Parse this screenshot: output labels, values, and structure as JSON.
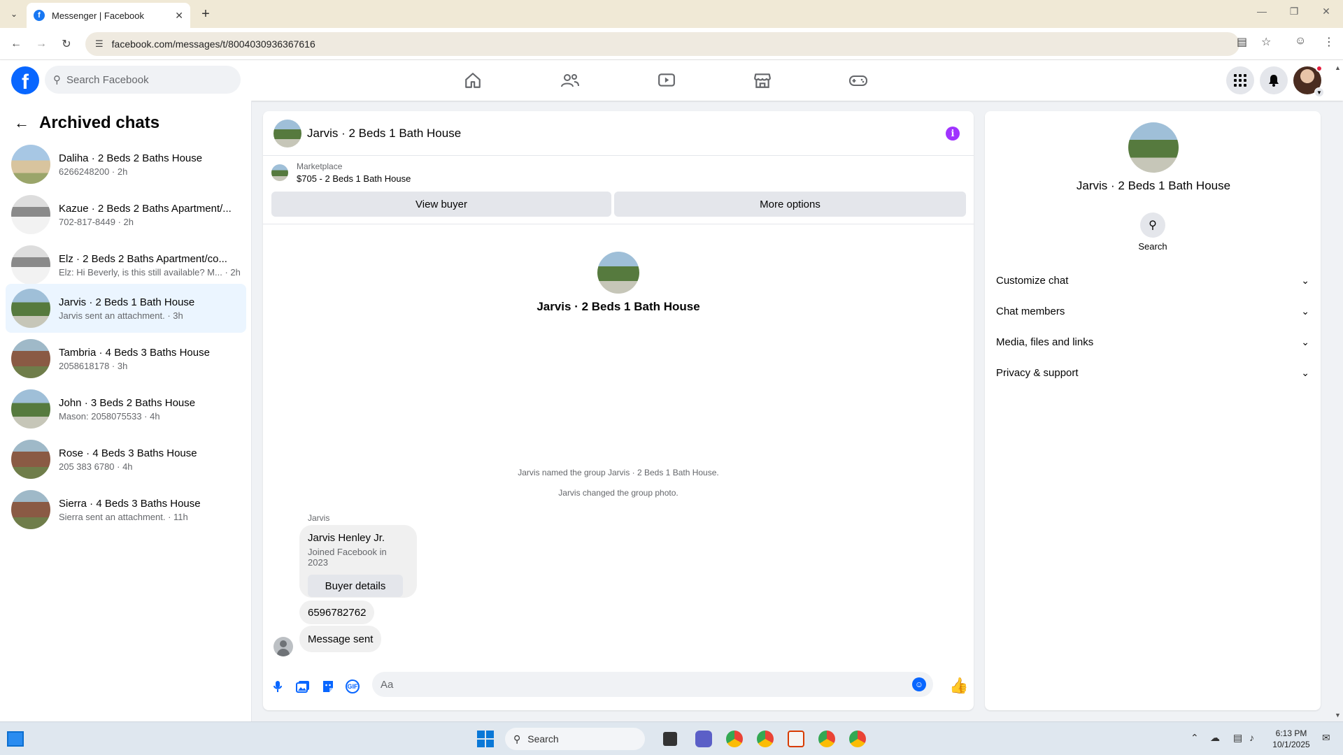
{
  "browser": {
    "tab_title": "Messenger | Facebook",
    "url": "facebook.com/messages/t/8004030936367616"
  },
  "fb": {
    "search_placeholder": "Search Facebook"
  },
  "sidebar": {
    "title": "Archived chats",
    "chats": [
      {
        "name": "Daliha · 2 Beds 2 Baths House",
        "sub": "6266248200 · 2h"
      },
      {
        "name": "Kazue · 2 Beds 2 Baths Apartment/...",
        "sub": "702-817-8449 · 2h"
      },
      {
        "name": "Elz · 2 Beds 2 Baths Apartment/co...",
        "sub": "Elz: Hi Beverly, is this still available? M... · 2h"
      },
      {
        "name": "Jarvis · 2 Beds 1 Bath House",
        "sub": "Jarvis sent an attachment. · 3h"
      },
      {
        "name": "Tambria · 4 Beds 3 Baths House",
        "sub": "2058618178 · 3h"
      },
      {
        "name": "John · 3 Beds 2 Baths House",
        "sub": "Mason: 2058075533 · 4h"
      },
      {
        "name": "Rose · 4 Beds 3 Baths House",
        "sub": "205 383 6780 · 4h"
      },
      {
        "name": "Sierra · 4 Beds 3 Baths House",
        "sub": "Sierra sent an attachment. · 11h"
      }
    ]
  },
  "conversation": {
    "title": "Jarvis · 2 Beds 1 Bath House",
    "marketplace_label": "Marketplace",
    "marketplace_item": "$705 - 2 Beds 1 Bath House",
    "view_buyer": "View buyer",
    "more_options": "More options",
    "center_name": "Jarvis · 2 Beds 1 Bath House",
    "system_messages": [
      "Jarvis named the group Jarvis · 2 Beds 1 Bath House.",
      "Jarvis changed the group photo."
    ],
    "sender": "Jarvis",
    "card_name": "Jarvis Henley Jr.",
    "card_sub": "Joined Facebook in 2023",
    "card_button": "Buyer details",
    "bubble_phone": "6596782762",
    "bubble_sent": "Message sent",
    "composer_placeholder": "Aa"
  },
  "info_panel": {
    "name": "Jarvis · 2 Beds 1 Bath House",
    "search_label": "Search",
    "sections": [
      "Customize chat",
      "Chat members",
      "Media, files and links",
      "Privacy & support"
    ]
  },
  "taskbar": {
    "search": "Search",
    "time": "6:13 PM",
    "date": "10/1/2025"
  },
  "colors": {
    "facebook_blue": "#0866ff",
    "info_purple": "#a033ff",
    "active_chat_bg": "#ebf5ff"
  }
}
